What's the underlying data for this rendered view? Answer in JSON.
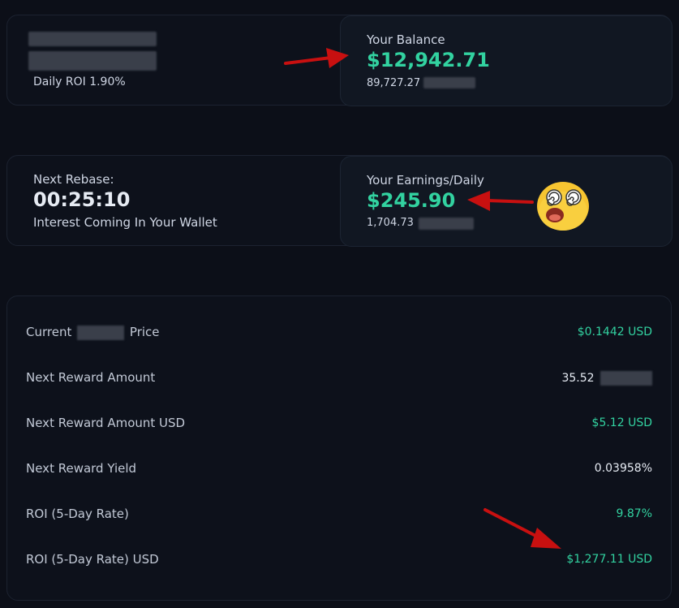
{
  "top_card": {
    "daily_roi_label": "Daily ROI 1.90%"
  },
  "balance": {
    "title": "Your Balance",
    "usd": "$12,942.71",
    "tokens": "89,727.27"
  },
  "rebase": {
    "title": "Next Rebase:",
    "timer": "00:25:10",
    "subtitle": "Interest Coming In Your Wallet"
  },
  "earnings": {
    "title": "Your Earnings/Daily",
    "usd": "$245.90",
    "tokens": "1,704.73"
  },
  "stats": {
    "rows": [
      {
        "label_pre": "Current",
        "label_post": "Price",
        "value": "$0.1442 USD",
        "color": "green"
      },
      {
        "label": "Next Reward Amount",
        "value": "35.52",
        "color": "white"
      },
      {
        "label": "Next Reward Amount USD",
        "value": "$5.12 USD",
        "color": "green"
      },
      {
        "label": "Next Reward Yield",
        "value": "0.03958%",
        "color": "white"
      },
      {
        "label": "ROI (5-Day Rate)",
        "value": "9.87%",
        "color": "green"
      },
      {
        "label": "ROI (5-Day Rate) USD",
        "value": "$1,277.11 USD",
        "color": "green"
      }
    ]
  },
  "annotations": {
    "arrow_color": "#d01010",
    "emoji_icon": "dizzy-face-emoji-icon"
  },
  "colors": {
    "accent_green": "#32d2a0",
    "background": "#0c0f18"
  }
}
